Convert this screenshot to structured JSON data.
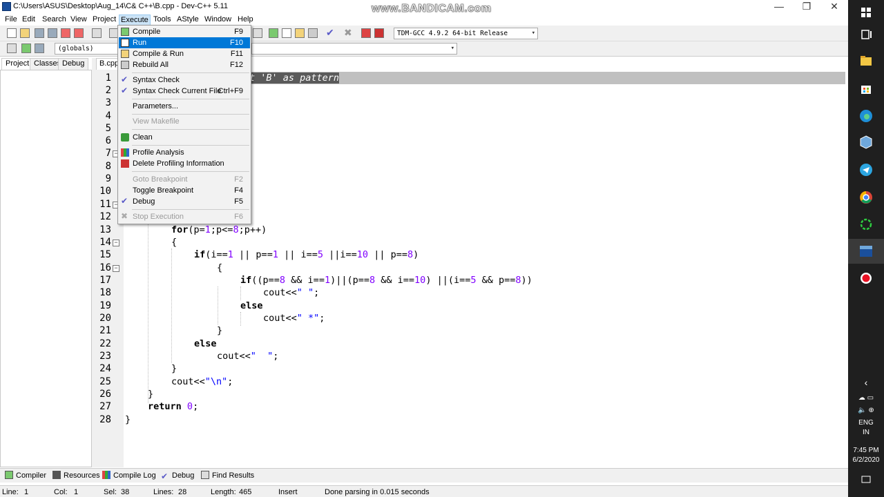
{
  "window": {
    "title": "C:\\Users\\ASUS\\Desktop\\Aug_14\\C& C++\\B.cpp - Dev-C++ 5.11",
    "watermark": "www.BANDICAM.com",
    "controls": {
      "minimize": "—",
      "maximize": "❐",
      "close": "✕"
    }
  },
  "menubar": {
    "items": [
      "File",
      "Edit",
      "Search",
      "View",
      "Project",
      "Execute",
      "Tools",
      "AStyle",
      "Window",
      "Help"
    ]
  },
  "toolbar": {
    "compiler_select": "TDM-GCC 4.9.2 64-bit Release",
    "scope_select": "(globals)"
  },
  "execute_menu": {
    "items": [
      {
        "label": "Compile",
        "shortcut": "F9"
      },
      {
        "label": "Run",
        "shortcut": "F10"
      },
      {
        "label": "Compile & Run",
        "shortcut": "F11"
      },
      {
        "label": "Rebuild All",
        "shortcut": "F12"
      },
      {
        "label": "Syntax Check",
        "shortcut": ""
      },
      {
        "label": "Syntax Check Current File",
        "shortcut": "Ctrl+F9"
      },
      {
        "label": "Parameters...",
        "shortcut": ""
      },
      {
        "label": "View Makefile",
        "shortcut": ""
      },
      {
        "label": "Clean",
        "shortcut": ""
      },
      {
        "label": "Profile Analysis",
        "shortcut": ""
      },
      {
        "label": "Delete Profiling Information",
        "shortcut": ""
      },
      {
        "label": "Goto Breakpoint",
        "shortcut": "F2"
      },
      {
        "label": "Toggle Breakpoint",
        "shortcut": "F4"
      },
      {
        "label": "Debug",
        "shortcut": "F5"
      },
      {
        "label": "Stop Execution",
        "shortcut": "F6"
      }
    ]
  },
  "left_tabs": [
    "Project",
    "Classes",
    "Debug"
  ],
  "editor": {
    "file_tab": "B.cpp",
    "visible_comment": "t 'B' as pattern",
    "line_numbers": [
      "1",
      "2",
      "3",
      "4",
      "5",
      "6",
      "7",
      "8",
      "9",
      "10",
      "11",
      "12",
      "13",
      "14",
      "15",
      "16",
      "17",
      "18",
      "19",
      "20",
      "21",
      "22",
      "23",
      "24",
      "25",
      "26",
      "27",
      "28"
    ],
    "code": {
      "l13_kw": "for",
      "l13_a": "(p=",
      "l13_n1": "1",
      "l13_b": ";p<=",
      "l13_n2": "8",
      "l13_c": ";p++)",
      "l14": "{",
      "l15_kw": "if",
      "l15_a": "(i==",
      "l15_n1": "1",
      "l15_b": " || p==",
      "l15_n2": "1",
      "l15_c": " || i==",
      "l15_n3": "5",
      "l15_d": " ||i==",
      "l15_n4": "10",
      "l15_e": " || p==",
      "l15_n5": "8",
      "l15_f": ")",
      "l16": "{",
      "l17_kw": "if",
      "l17_a": "((p==",
      "l17_n1": "8",
      "l17_b": " && i==",
      "l17_n2": "1",
      "l17_c": ")||(p==",
      "l17_n3": "8",
      "l17_d": " && i==",
      "l17_n4": "10",
      "l17_e": ") ||(i==",
      "l17_n5": "5",
      "l17_f": " && p==",
      "l17_n6": "8",
      "l17_g": "))",
      "l18_a": "cout<<",
      "l18_s": "\" \"",
      "l18_b": ";",
      "l19_kw": "else",
      "l20_a": "cout<<",
      "l20_s": "\" *\"",
      "l20_b": ";",
      "l21": "}",
      "l22_kw": "else",
      "l23_a": "cout<<",
      "l23_s": "\"  \"",
      "l23_b": ";",
      "l24": "}",
      "l25_a": "cout<<",
      "l25_s": "\"\\n\"",
      "l25_b": ";",
      "l26": "}",
      "l27_kw": "return",
      "l27_n": "0",
      "l27_b": ";",
      "l28": "}"
    }
  },
  "bottom_tabs": [
    "Compiler",
    "Resources",
    "Compile Log",
    "Debug",
    "Find Results"
  ],
  "status": {
    "line_label": "Line:",
    "line_value": "1",
    "col_label": "Col:",
    "col_value": "1",
    "sel_label": "Sel:",
    "sel_value": "38",
    "lines_label": "Lines:",
    "lines_value": "28",
    "length_label": "Length:",
    "length_value": "465",
    "mode": "Insert",
    "message": "Done parsing in 0.015 seconds"
  },
  "taskbar": {
    "lang": "ENG",
    "region": "IN",
    "time": "7:45 PM",
    "date": "6/2/2020",
    "icons": [
      "windows-icon",
      "task-view-icon",
      "file-explorer-icon",
      "store-icon",
      "edge-icon",
      "virtualbox-icon",
      "telegram-icon",
      "chrome-icon",
      "loader-icon",
      "devcpp-icon",
      "record-icon"
    ]
  },
  "colors": {
    "menu_highlight": "#0078d7",
    "taskbar": "#1f1f1f",
    "keyword_number": "#8000ff",
    "string": "#0000ff"
  }
}
